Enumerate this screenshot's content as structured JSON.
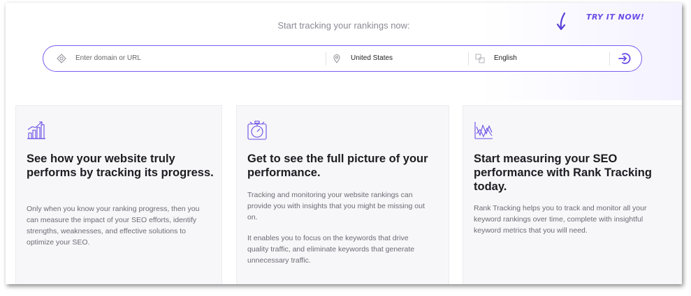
{
  "hero": {
    "title": "Start tracking your rankings now:",
    "try_now": "TRY IT NOW!"
  },
  "search": {
    "domain_placeholder": "Enter domain or URL",
    "domain_value": "",
    "country": "United States",
    "language": "English",
    "icons": {
      "domain": "target-icon",
      "country": "location-pin-icon",
      "language": "translate-icon",
      "go": "login-arrow-icon"
    }
  },
  "cards": [
    {
      "icon": "growth-chart-icon",
      "title": "See how your website truly performs by tracking its progress.",
      "paragraphs": [
        "Only when you know your ranking progress, then you can measure the impact of your SEO efforts, identify strengths, weaknesses, and effective solutions to optimize your SEO."
      ]
    },
    {
      "icon": "stopwatch-icon",
      "title": "Get to see the full picture of your performance.",
      "paragraphs": [
        "Tracking and monitoring your website rankings can provide you with insights that you might be missing out on.",
        "It enables you to focus on the keywords that drive quality traffic, and eliminate keywords that generate unnecessary traffic."
      ]
    },
    {
      "icon": "line-graph-icon",
      "title": "Start measuring your SEO performance with Rank Tracking today.",
      "paragraphs": [
        "Rank Tracking helps you to track and monitor all your keyword rankings over time, complete with insightful keyword metrics that you will need."
      ]
    }
  ],
  "colors": {
    "accent": "#7b5cf0",
    "title": "#1c1c22",
    "body": "#6b6b75",
    "card_bg": "#f7f7f9"
  }
}
